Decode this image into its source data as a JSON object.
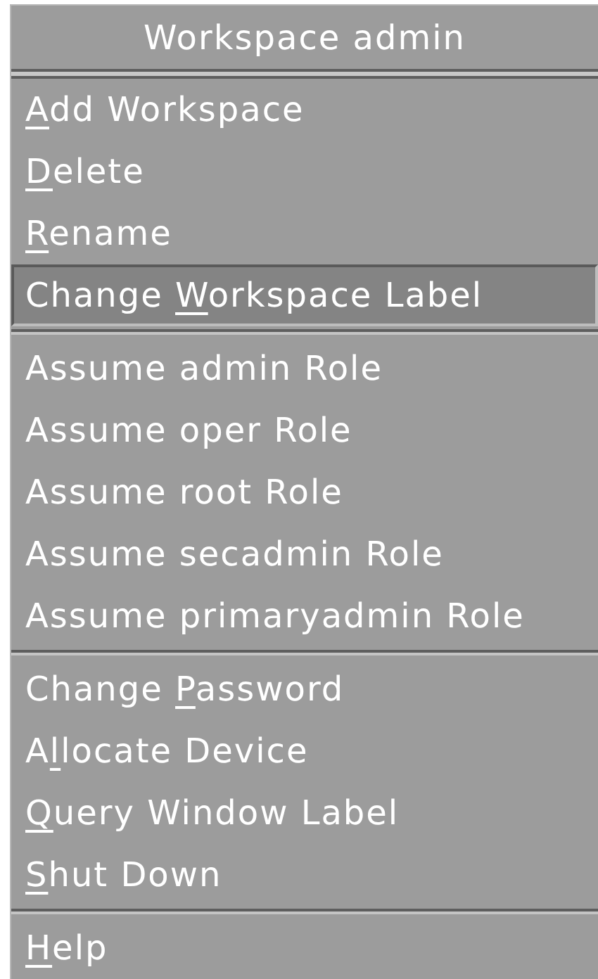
{
  "menu": {
    "title": "Workspace admin",
    "groups": [
      [
        {
          "mnemonic": "A",
          "after": "dd Workspace",
          "selected": false
        },
        {
          "mnemonic": "D",
          "after": "elete",
          "selected": false
        },
        {
          "mnemonic": "R",
          "after": "ename",
          "selected": false
        },
        {
          "before": "Change ",
          "mnemonic": "W",
          "after": "orkspace Label",
          "selected": true
        }
      ],
      [
        {
          "before": "Assume admin Role",
          "selected": false
        },
        {
          "before": "Assume oper Role",
          "selected": false
        },
        {
          "before": "Assume root Role",
          "selected": false
        },
        {
          "before": "Assume secadmin Role",
          "selected": false
        },
        {
          "before": "Assume primaryadmin Role",
          "selected": false
        }
      ],
      [
        {
          "before": "Change ",
          "mnemonic": "P",
          "after": "assword",
          "selected": false
        },
        {
          "before": "A",
          "mnemonic": "l",
          "after": "locate Device",
          "selected": false
        },
        {
          "mnemonic": "Q",
          "after": "uery Window Label",
          "selected": false
        },
        {
          "mnemonic": "S",
          "after": "hut Down",
          "selected": false
        }
      ],
      [
        {
          "mnemonic": "H",
          "after": "elp",
          "selected": false
        }
      ]
    ]
  }
}
